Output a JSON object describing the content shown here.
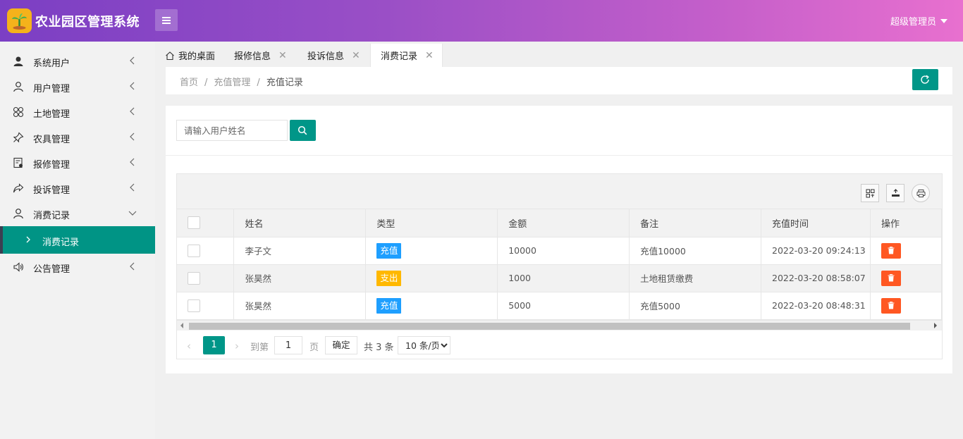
{
  "header": {
    "app_title": "农业园区管理系统",
    "user_name": "超级管理员",
    "accent": "#009688",
    "gradient_start": "#7b3fc4",
    "gradient_end": "#e870cf"
  },
  "sidebar": {
    "items": [
      {
        "label": "系统用户",
        "icon": "user-filled-icon"
      },
      {
        "label": "用户管理",
        "icon": "user-outline-icon"
      },
      {
        "label": "土地管理",
        "icon": "clover-icon"
      },
      {
        "label": "农具管理",
        "icon": "pin-icon"
      },
      {
        "label": "报修管理",
        "icon": "repair-icon"
      },
      {
        "label": "投诉管理",
        "icon": "share-arrow-icon"
      },
      {
        "label": "消费记录",
        "icon": "user-outline-icon",
        "expanded": true
      },
      {
        "label": "公告管理",
        "icon": "speaker-icon"
      }
    ],
    "sub_item": {
      "label": "消费记录"
    }
  },
  "tabs": [
    {
      "label": "我的桌面",
      "icon": "home-icon",
      "closable": false
    },
    {
      "label": "报修信息",
      "closable": true
    },
    {
      "label": "投诉信息",
      "closable": true
    },
    {
      "label": "消费记录",
      "closable": true,
      "active": true
    }
  ],
  "breadcrumb": {
    "home": "首页",
    "section": "充值管理",
    "current": "充值记录",
    "separator": "/"
  },
  "search": {
    "placeholder": "请输入用户姓名",
    "value": ""
  },
  "table": {
    "columns": [
      "姓名",
      "类型",
      "金额",
      "备注",
      "充值时间",
      "操作"
    ],
    "rows": [
      {
        "name": "李子文",
        "type": "充值",
        "type_color": "#1e9fff",
        "amount": "10000",
        "note": "充值10000",
        "time": "2022-03-20 09:24:13"
      },
      {
        "name": "张昊然",
        "type": "支出",
        "type_color": "#ffb800",
        "amount": "1000",
        "note": "土地租赁缴费",
        "time": "2022-03-20 08:58:07"
      },
      {
        "name": "张昊然",
        "type": "充值",
        "type_color": "#1e9fff",
        "amount": "5000",
        "note": "充值5000",
        "time": "2022-03-20 08:48:31"
      }
    ]
  },
  "pager": {
    "current_page": "1",
    "goto_label": "到第",
    "goto_value": "1",
    "page_label": "页",
    "confirm_label": "确定",
    "total_label": "共 3 条",
    "page_size": "10 条/页"
  }
}
